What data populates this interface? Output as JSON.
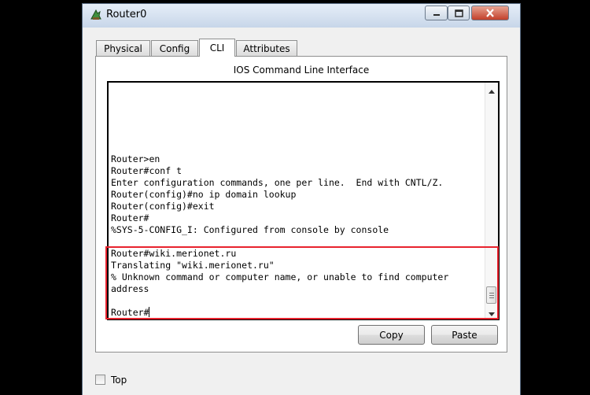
{
  "window": {
    "title": "Router0"
  },
  "tabs": [
    {
      "label": "Physical"
    },
    {
      "label": "Config"
    },
    {
      "label": "CLI"
    },
    {
      "label": "Attributes"
    }
  ],
  "active_tab": "CLI",
  "panel": {
    "title": "IOS Command Line Interface"
  },
  "console": {
    "lines": [
      "Router>en",
      "Router#conf t",
      "Enter configuration commands, one per line.  End with CNTL/Z.",
      "Router(config)#no ip domain lookup",
      "Router(config)#exit",
      "Router#",
      "%SYS-5-CONFIG_I: Configured from console by console",
      "",
      "Router#wiki.merionet.ru",
      "Translating \"wiki.merionet.ru\"",
      "% Unknown command or computer name, or unable to find computer",
      "address",
      "",
      "Router#"
    ]
  },
  "buttons": {
    "copy": "Copy",
    "paste": "Paste"
  },
  "top_checkbox": {
    "label": "Top",
    "checked": false
  },
  "colors": {
    "highlight_border": "#e8232e",
    "titlebar": "#dbe5f1",
    "close_button": "#c7432c"
  },
  "icons": {
    "app": "router-icon",
    "minimize": "minimize-icon",
    "maximize": "maximize-icon",
    "close": "close-icon",
    "scroll_up": "scroll-up-arrow-icon",
    "scroll_down": "scroll-down-arrow-icon"
  }
}
